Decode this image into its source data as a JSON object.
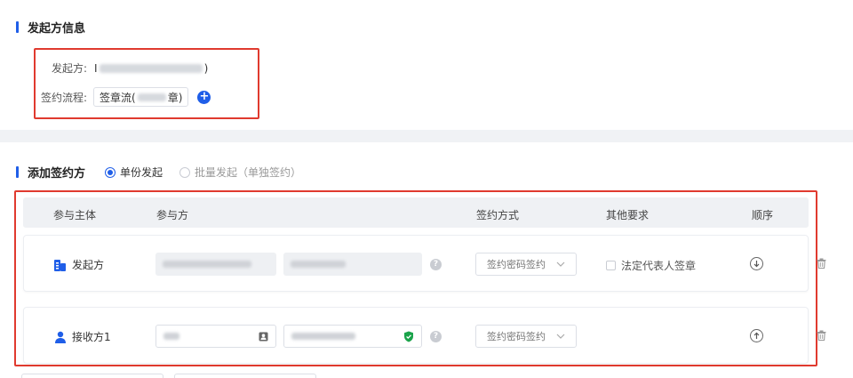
{
  "initiator_section": {
    "title": "发起方信息",
    "initiator_label": "发起方:",
    "initiator_value_prefix": "I",
    "initiator_value_suffix": ")",
    "flow_label": "签约流程:",
    "flow_value_prefix": "签章流(",
    "flow_value_suffix": "章)"
  },
  "signer_section": {
    "title": "添加签约方",
    "radio_single": "单份发起",
    "radio_batch": "批量发起（单独签约）",
    "selected": "single"
  },
  "table": {
    "headers": [
      "参与主体",
      "参与方",
      "签约方式",
      "其他要求",
      "顺序"
    ],
    "rows": [
      {
        "subject": "发起方",
        "sign_method": "签约密码签约",
        "other_requirement": "法定代表人签章"
      },
      {
        "subject": "接收方1",
        "sign_method": "签约密码签约"
      }
    ]
  },
  "colors": {
    "accent": "#1f5ee8",
    "highlight": "#e03a2f",
    "verified": "#1aa34a"
  }
}
